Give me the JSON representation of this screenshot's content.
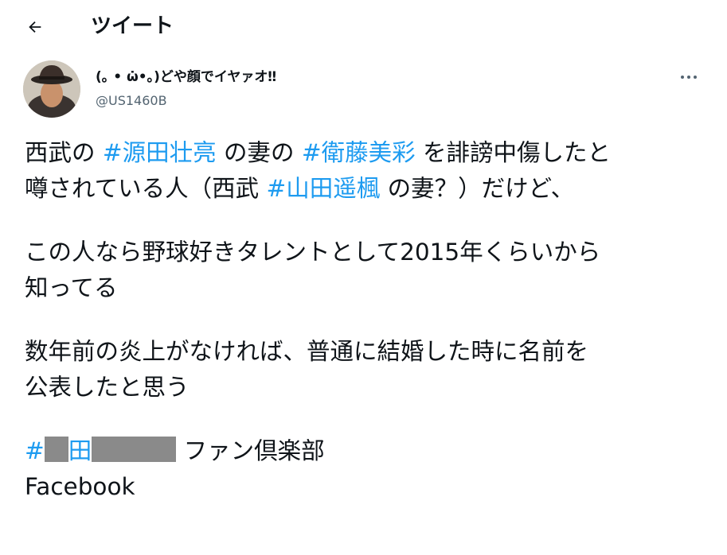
{
  "header": {
    "title": "ツイート",
    "back_icon": "arrow-left-icon"
  },
  "tweet": {
    "author": {
      "display_name": "(｡ • ω̇•｡)どや顔でイヤァオ‼",
      "handle": "@US1460B",
      "avatar": "man-in-fedora-avatar"
    },
    "more_icon": "more-dots-icon",
    "body": {
      "p1_prefix": "西武の ",
      "p1_tag1": "#源田壮亮",
      "p1_mid1": " の妻の ",
      "p1_tag2": "#衛藤美彩",
      "p1_mid2": " を誹謗中傷したと",
      "p1_l2_prefix": "噂されている人（西武 ",
      "p1_tag3": "#山田遥楓",
      "p1_l2_suffix": " の妻？）だけど、",
      "p2_line1": "この人なら野球好きタレントとして2015年くらいから",
      "p2_line2": "知ってる",
      "p3_line1": "数年前の炎上がなければ、普通に結婚した時に名前を",
      "p3_line2": "公表したと思う",
      "p4_tag_hash": "#",
      "p4_tag_visible": "田",
      "p4_suffix": " ファン倶楽部",
      "p5": "Facebook"
    }
  }
}
